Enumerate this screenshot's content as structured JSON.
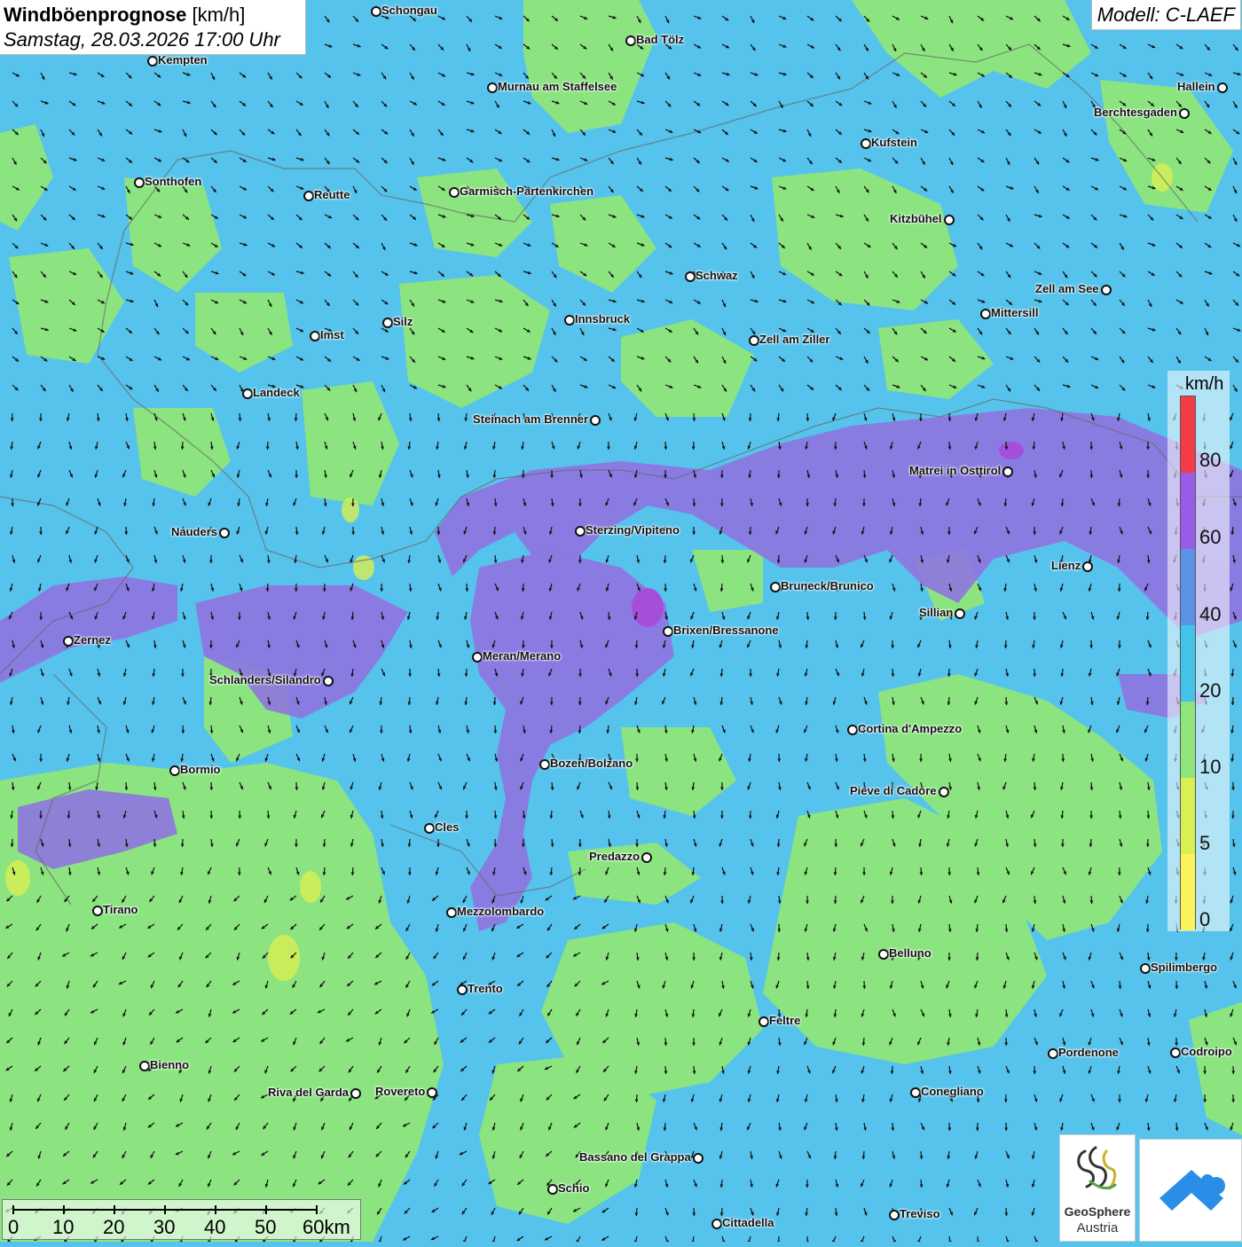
{
  "title": {
    "main": "Windböenprognose",
    "unit": "[km/h]",
    "datetime": "Samstag, 28.03.2026 17:00 Uhr"
  },
  "model": "Modell: C-LAEF",
  "legend": {
    "unit": "km/h",
    "labels": [
      "80",
      "60",
      "40",
      "20",
      "10",
      "5",
      "0"
    ],
    "colors": [
      "#f43c46",
      "#9a5ce6",
      "#5a93e6",
      "#41c3ea",
      "#8ee67a",
      "#d9ef52",
      "#fbf35a"
    ]
  },
  "scale_bar": {
    "labels": [
      "0",
      "10",
      "20",
      "30",
      "40",
      "50",
      "60km"
    ]
  },
  "logos": {
    "geosphere_name": "GeoSphere",
    "geosphere_sub": "Austria"
  },
  "cities": [
    {
      "name": "Schongau"
    },
    {
      "name": "Bad Tölz"
    },
    {
      "name": "Kempten"
    },
    {
      "name": "Murnau am Staffelsee"
    },
    {
      "name": "Hallein"
    },
    {
      "name": "Berchtesgaden"
    },
    {
      "name": "Kufstein"
    },
    {
      "name": "Sonthofen"
    },
    {
      "name": "Reutte"
    },
    {
      "name": "Garmisch-Partenkirchen"
    },
    {
      "name": "Kitzbühel"
    },
    {
      "name": "Schwaz"
    },
    {
      "name": "Zell am See"
    },
    {
      "name": "Mittersill"
    },
    {
      "name": "Innsbruck"
    },
    {
      "name": "Silz"
    },
    {
      "name": "Imst"
    },
    {
      "name": "Zell am Ziller"
    },
    {
      "name": "Landeck"
    },
    {
      "name": "Steinach am Brenner"
    },
    {
      "name": "Matrei in Osttirol"
    },
    {
      "name": "Nauders"
    },
    {
      "name": "Sterzing/Vipiteno"
    },
    {
      "name": "Lienz"
    },
    {
      "name": "Bruneck/Brunico"
    },
    {
      "name": "Sillian"
    },
    {
      "name": "Brixen/Bressanone"
    },
    {
      "name": "Zernez"
    },
    {
      "name": "Meran/Merano"
    },
    {
      "name": "Schlanders/Silandro"
    },
    {
      "name": "Cortina d'Ampezzo"
    },
    {
      "name": "Bozen/Bolzano"
    },
    {
      "name": "Bormio"
    },
    {
      "name": "Pieve di Cadore"
    },
    {
      "name": "Cles"
    },
    {
      "name": "Predazzo"
    },
    {
      "name": "Tirano"
    },
    {
      "name": "Mezzolombardo"
    },
    {
      "name": "Belluno"
    },
    {
      "name": "Spilimbergo"
    },
    {
      "name": "Trento"
    },
    {
      "name": "Feltre"
    },
    {
      "name": "Pordenone"
    },
    {
      "name": "Codroipo"
    },
    {
      "name": "Bienno"
    },
    {
      "name": "Riva del Garda"
    },
    {
      "name": "Rovereto"
    },
    {
      "name": "Conegliano"
    },
    {
      "name": "Bassano del Grappa"
    },
    {
      "name": "Schio"
    },
    {
      "name": "Treviso"
    },
    {
      "name": "Cittadella"
    }
  ]
}
